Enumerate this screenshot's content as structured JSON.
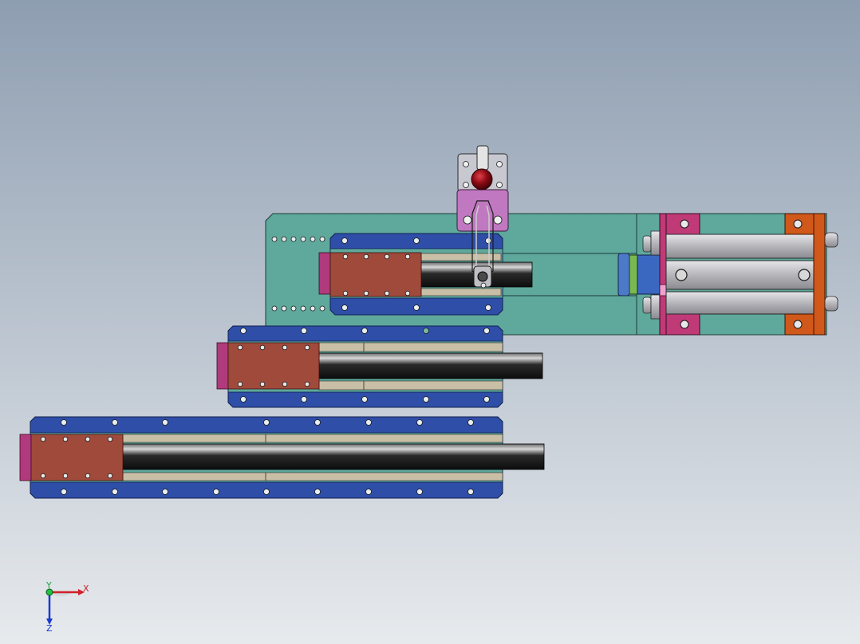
{
  "viewport": {
    "background_top": "#8f9fb2",
    "background_bottom": "#e6e9ec"
  },
  "colors": {
    "base_plate": "#5fa89c",
    "rail_blue": "#2f4ea8",
    "rail_blue_dark": "#1f3580",
    "carriage": "#a04a3c",
    "end_cap": "#b03a7c",
    "guide_tan": "#c9bfa6",
    "rod_dark": "#1a1a1a",
    "clamp_pink": "#c078c0",
    "knob_red": "#8b0a14",
    "cylinder_silver": "#c8c8cc",
    "bracket_orange": "#d0581a",
    "bracket_pink": "#c03a78"
  },
  "triad": {
    "x_label": "X",
    "y_label": "Y",
    "z_label": "Z"
  }
}
